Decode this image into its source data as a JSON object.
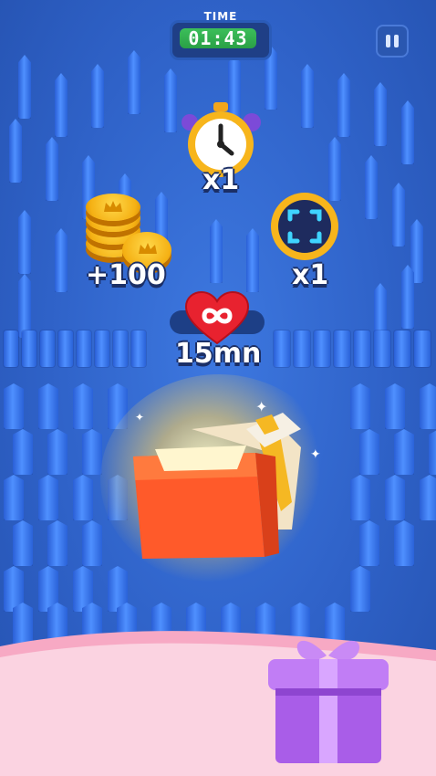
{
  "hud": {
    "time_label": "TIME",
    "time_value": "01:43"
  },
  "rewards": {
    "stopwatch": {
      "label": "x1",
      "icon": "stopwatch-icon"
    },
    "coins": {
      "label": "+100",
      "icon": "coin-stack-icon"
    },
    "focus": {
      "label": "x1",
      "icon": "focus-target-icon"
    },
    "infinite_lives": {
      "label": "15mn",
      "icon": "infinite-heart-icon"
    }
  },
  "colors": {
    "background": "#2f62c8",
    "pillar": "#4f90ff",
    "timer_green": "#3cbf5a",
    "gift_box": "#ff5a2a",
    "heart": "#e8222f",
    "bottom_pink": "#f7a9c4",
    "purple_gift": "#b66cf0"
  }
}
